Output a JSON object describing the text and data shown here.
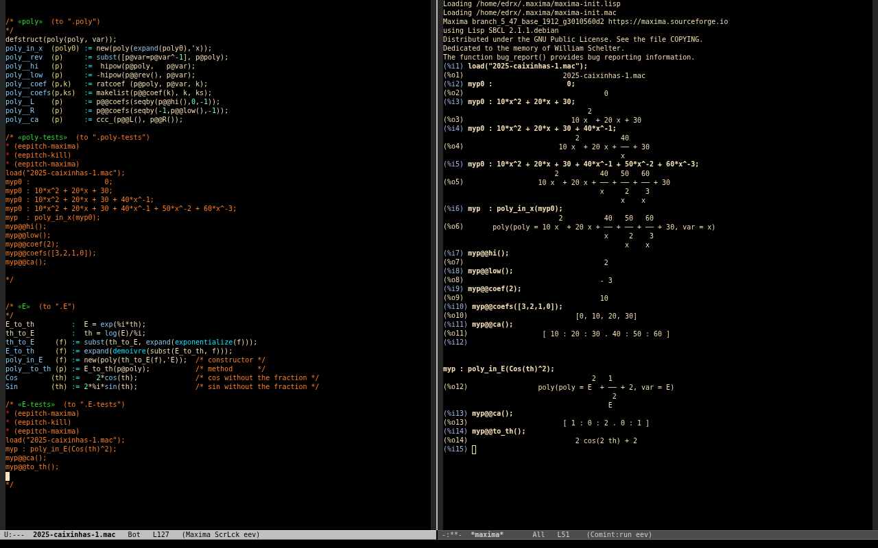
{
  "windows": [
    {
      "kind": "source",
      "selected": true,
      "lines": [
        {
          "kind": "blank"
        },
        {
          "kind": "blank"
        },
        {
          "kind": "code",
          "parts": [
            {
              "kind": "comment",
              "text": "/* "
            },
            {
              "kind": "anchor",
              "text": "«poly»"
            },
            {
              "kind": "comment",
              "text": "  (to \".poly\")"
            }
          ]
        },
        {
          "kind": "code",
          "parts": [
            {
              "kind": "comment",
              "text": "*/"
            }
          ]
        },
        {
          "kind": "code",
          "parts": [
            {
              "kind": "plain",
              "text": "defstruct(poly(poly, var));"
            }
          ]
        },
        {
          "kind": "code",
          "parts": [
            {
              "kind": "def",
              "text": "poly_in_x  "
            },
            {
              "kind": "param",
              "text": "(poly0) "
            },
            {
              "kind": "op",
              "text": ":= "
            },
            {
              "kind": "plain",
              "text": "new(poly("
            },
            {
              "kind": "builtin",
              "text": "expand"
            },
            {
              "kind": "plain",
              "text": "(poly0),'x));"
            }
          ]
        },
        {
          "kind": "code",
          "parts": [
            {
              "kind": "def",
              "text": "poly__rev  "
            },
            {
              "kind": "param",
              "text": "(p)     "
            },
            {
              "kind": "op",
              "text": ":= "
            },
            {
              "kind": "builtin",
              "text": "subst"
            },
            {
              "kind": "plain",
              "text": "([p@var=p@var^"
            },
            {
              "kind": "number",
              "text": "-1"
            },
            {
              "kind": "plain",
              "text": "], p@poly);"
            }
          ]
        },
        {
          "kind": "code",
          "parts": [
            {
              "kind": "def",
              "text": "poly__hi   "
            },
            {
              "kind": "param",
              "text": "(p)     "
            },
            {
              "kind": "op",
              "text": ":= "
            },
            {
              "kind": "plain",
              "text": " hipow(p@poly,   p@var);"
            }
          ]
        },
        {
          "kind": "code",
          "parts": [
            {
              "kind": "def",
              "text": "poly__low  "
            },
            {
              "kind": "param",
              "text": "(p)     "
            },
            {
              "kind": "op",
              "text": ":= "
            },
            {
              "kind": "plain",
              "text": "-hipow(p@@rev(), p@var);"
            }
          ]
        },
        {
          "kind": "code",
          "parts": [
            {
              "kind": "def",
              "text": "poly__coef "
            },
            {
              "kind": "param",
              "text": "(p,k)   "
            },
            {
              "kind": "op",
              "text": ":= "
            },
            {
              "kind": "plain",
              "text": "ratcoef (p@poly, p@var, k);"
            }
          ]
        },
        {
          "kind": "code",
          "parts": [
            {
              "kind": "def",
              "text": "poly__coefs"
            },
            {
              "kind": "param",
              "text": "(p,ks)  "
            },
            {
              "kind": "op",
              "text": ":= "
            },
            {
              "kind": "plain",
              "text": "makelist(p@@coef(k), k, ks);"
            }
          ]
        },
        {
          "kind": "code",
          "parts": [
            {
              "kind": "def",
              "text": "poly__L    "
            },
            {
              "kind": "param",
              "text": "(p)     "
            },
            {
              "kind": "op",
              "text": ":= "
            },
            {
              "kind": "plain",
              "text": "p@@coefs(seqby(p@@hi(),"
            },
            {
              "kind": "number",
              "text": "0"
            },
            {
              "kind": "plain",
              "text": ","
            },
            {
              "kind": "number",
              "text": "-1"
            },
            {
              "kind": "plain",
              "text": "));"
            }
          ]
        },
        {
          "kind": "code",
          "parts": [
            {
              "kind": "def",
              "text": "poly__R    "
            },
            {
              "kind": "param",
              "text": "(p)     "
            },
            {
              "kind": "op",
              "text": ":= "
            },
            {
              "kind": "plain",
              "text": "p@@coefs(seqby("
            },
            {
              "kind": "number",
              "text": "-1"
            },
            {
              "kind": "plain",
              "text": ",p@@low(),"
            },
            {
              "kind": "number",
              "text": "-1"
            },
            {
              "kind": "plain",
              "text": "));"
            }
          ]
        },
        {
          "kind": "code",
          "parts": [
            {
              "kind": "def",
              "text": "poly__ca   "
            },
            {
              "kind": "param",
              "text": "(p)     "
            },
            {
              "kind": "op",
              "text": ":= "
            },
            {
              "kind": "plain",
              "text": "ccc_(p@@L(), p@@R());"
            }
          ]
        },
        {
          "kind": "blank"
        },
        {
          "kind": "code",
          "parts": [
            {
              "kind": "comment",
              "text": "/* "
            },
            {
              "kind": "anchor",
              "text": "«poly-tests»"
            },
            {
              "kind": "comment",
              "text": "  (to \".poly-tests\")"
            }
          ]
        },
        {
          "kind": "code",
          "parts": [
            {
              "kind": "star",
              "text": "*"
            },
            {
              "kind": "comment",
              "text": " (eepitch-maxima)"
            }
          ]
        },
        {
          "kind": "code",
          "parts": [
            {
              "kind": "star",
              "text": "*"
            },
            {
              "kind": "comment",
              "text": " (eepitch-kill)"
            }
          ]
        },
        {
          "kind": "code",
          "parts": [
            {
              "kind": "star",
              "text": "*"
            },
            {
              "kind": "comment",
              "text": " (eepitch-maxima)"
            }
          ]
        },
        {
          "kind": "code",
          "parts": [
            {
              "kind": "comment",
              "text": "load(\"2025-caixinhas-1.mac\");"
            }
          ]
        },
        {
          "kind": "code",
          "parts": [
            {
              "kind": "comment",
              "text": "myp0 :                  0;"
            }
          ]
        },
        {
          "kind": "code",
          "parts": [
            {
              "kind": "comment",
              "text": "myp0 : 10*x^2 + 20*x + 30;"
            }
          ]
        },
        {
          "kind": "code",
          "parts": [
            {
              "kind": "comment",
              "text": "myp0 : 10*x^2 + 20*x + 30 + 40*x^-1;"
            }
          ]
        },
        {
          "kind": "code",
          "parts": [
            {
              "kind": "comment",
              "text": "myp0 : 10*x^2 + 20*x + 30 + 40*x^-1 + 50*x^-2 + 60*x^-3;"
            }
          ]
        },
        {
          "kind": "code",
          "parts": [
            {
              "kind": "comment",
              "text": "myp  : poly_in_x(myp0);"
            }
          ]
        },
        {
          "kind": "code",
          "parts": [
            {
              "kind": "comment",
              "text": "myp@@hi();"
            }
          ]
        },
        {
          "kind": "code",
          "parts": [
            {
              "kind": "comment",
              "text": "myp@@low();"
            }
          ]
        },
        {
          "kind": "code",
          "parts": [
            {
              "kind": "comment",
              "text": "myp@@coef(2);"
            }
          ]
        },
        {
          "kind": "code",
          "parts": [
            {
              "kind": "comment",
              "text": "myp@@coefs([3,2,1,0]);"
            }
          ]
        },
        {
          "kind": "code",
          "parts": [
            {
              "kind": "comment",
              "text": "myp@@ca();"
            }
          ]
        },
        {
          "kind": "blank"
        },
        {
          "kind": "code",
          "parts": [
            {
              "kind": "comment",
              "text": "*/"
            }
          ]
        },
        {
          "kind": "blank"
        },
        {
          "kind": "blank"
        },
        {
          "kind": "code",
          "parts": [
            {
              "kind": "comment",
              "text": "/* "
            },
            {
              "kind": "anchor",
              "text": "«E»"
            },
            {
              "kind": "comment",
              "text": "  (to \".E\")"
            }
          ]
        },
        {
          "kind": "code",
          "parts": [
            {
              "kind": "comment",
              "text": "*/"
            }
          ]
        },
        {
          "kind": "code",
          "parts": [
            {
              "kind": "plain",
              "text": "E_to_th         "
            },
            {
              "kind": "op",
              "text": ":  "
            },
            {
              "kind": "plain",
              "text": "E = "
            },
            {
              "kind": "builtin",
              "text": "exp"
            },
            {
              "kind": "plain",
              "text": "(%i*th);"
            }
          ]
        },
        {
          "kind": "code",
          "parts": [
            {
              "kind": "plain",
              "text": "th_to_E         "
            },
            {
              "kind": "op",
              "text": ":  "
            },
            {
              "kind": "plain",
              "text": "th = "
            },
            {
              "kind": "builtin",
              "text": "log"
            },
            {
              "kind": "plain",
              "text": "(E)/%i;"
            }
          ]
        },
        {
          "kind": "code",
          "parts": [
            {
              "kind": "def",
              "text": "th_to_E     "
            },
            {
              "kind": "param",
              "text": "(f) "
            },
            {
              "kind": "op",
              "text": ":= "
            },
            {
              "kind": "builtin",
              "text": "subst"
            },
            {
              "kind": "plain",
              "text": "(th_to_E, "
            },
            {
              "kind": "builtin",
              "text": "expand"
            },
            {
              "kind": "plain",
              "text": "("
            },
            {
              "kind": "keyword",
              "text": "exponentialize"
            },
            {
              "kind": "plain",
              "text": "(f)));"
            }
          ]
        },
        {
          "kind": "code",
          "parts": [
            {
              "kind": "def",
              "text": "E_to_th     "
            },
            {
              "kind": "param",
              "text": "(f) "
            },
            {
              "kind": "op",
              "text": ":= "
            },
            {
              "kind": "builtin",
              "text": "expand"
            },
            {
              "kind": "plain",
              "text": "("
            },
            {
              "kind": "keyword",
              "text": "demoivre"
            },
            {
              "kind": "plain",
              "text": "(subst(E_to_th, f)));"
            }
          ]
        },
        {
          "kind": "code",
          "parts": [
            {
              "kind": "def",
              "text": "poly_in_E   "
            },
            {
              "kind": "param",
              "text": "(f) "
            },
            {
              "kind": "op",
              "text": ":= "
            },
            {
              "kind": "plain",
              "text": "new(poly(th_to_E(f),'E));  "
            },
            {
              "kind": "comment",
              "text": "/* constructor */"
            }
          ]
        },
        {
          "kind": "code",
          "parts": [
            {
              "kind": "def",
              "text": "poly__to_th "
            },
            {
              "kind": "param",
              "text": "(p) "
            },
            {
              "kind": "op",
              "text": ":= "
            },
            {
              "kind": "plain",
              "text": "E_to_th(p@poly);           "
            },
            {
              "kind": "comment",
              "text": "/* method      */"
            }
          ]
        },
        {
          "kind": "code",
          "parts": [
            {
              "kind": "def",
              "text": "Cos        "
            },
            {
              "kind": "param",
              "text": "(th) "
            },
            {
              "kind": "op",
              "text": ":=    "
            },
            {
              "kind": "number",
              "text": "2"
            },
            {
              "kind": "plain",
              "text": "*"
            },
            {
              "kind": "builtin",
              "text": "cos"
            },
            {
              "kind": "plain",
              "text": "(th);              "
            },
            {
              "kind": "comment",
              "text": "/* cos without the fraction */"
            }
          ]
        },
        {
          "kind": "code",
          "parts": [
            {
              "kind": "def",
              "text": "Sin        "
            },
            {
              "kind": "param",
              "text": "(th) "
            },
            {
              "kind": "op",
              "text": ":= "
            },
            {
              "kind": "number",
              "text": "2"
            },
            {
              "kind": "plain",
              "text": "*%i*"
            },
            {
              "kind": "builtin",
              "text": "sin"
            },
            {
              "kind": "plain",
              "text": "(th);              "
            },
            {
              "kind": "comment",
              "text": "/* sin without the fraction */"
            }
          ]
        },
        {
          "kind": "blank"
        },
        {
          "kind": "code",
          "parts": [
            {
              "kind": "comment",
              "text": "/* "
            },
            {
              "kind": "anchor",
              "text": "«E-tests»"
            },
            {
              "kind": "comment",
              "text": "  (to \".E-tests\")"
            }
          ]
        },
        {
          "kind": "code",
          "parts": [
            {
              "kind": "star",
              "text": "*"
            },
            {
              "kind": "comment",
              "text": " (eepitch-maxima)"
            }
          ]
        },
        {
          "kind": "code",
          "parts": [
            {
              "kind": "star",
              "text": "*"
            },
            {
              "kind": "comment",
              "text": " (eepitch-kill)"
            }
          ]
        },
        {
          "kind": "code",
          "parts": [
            {
              "kind": "star",
              "text": "*"
            },
            {
              "kind": "comment",
              "text": " (eepitch-maxima)"
            }
          ]
        },
        {
          "kind": "code",
          "parts": [
            {
              "kind": "comment",
              "text": "load(\"2025-caixinhas-1.mac\");"
            }
          ]
        },
        {
          "kind": "code",
          "parts": [
            {
              "kind": "comment",
              "text": "myp : poly_in_E(Cos(th)^2);"
            }
          ]
        },
        {
          "kind": "code",
          "parts": [
            {
              "kind": "comment",
              "text": "myp@@ca();"
            }
          ]
        },
        {
          "kind": "code",
          "parts": [
            {
              "kind": "comment",
              "text": "myp@@to_th();"
            }
          ]
        },
        {
          "kind": "cursor"
        },
        {
          "kind": "code",
          "parts": [
            {
              "kind": "comment",
              "text": "*/"
            }
          ]
        }
      ],
      "mode_line": {
        "state": "U:---",
        "buffer": "2025-caixinhas-1.mac",
        "position": "Bot",
        "line": "L127",
        "modes": "(Maxima ScrLck eev)"
      }
    },
    {
      "kind": "repl",
      "selected": false,
      "lines": [
        {
          "kind": "text",
          "text": "Loading /home/edrx/.maxima/maxima-init.lisp"
        },
        {
          "kind": "text",
          "text": "Loading /home/edrx/.maxima/maxima-init.mac"
        },
        {
          "kind": "text",
          "text": "Maxima branch_5_47_base_1912_g3010560d2 https://maxima.sourceforge.io"
        },
        {
          "kind": "text",
          "text": "using Lisp SBCL 2.1.1.debian"
        },
        {
          "kind": "text",
          "text": "Distributed under the GNU Public License. See the file COPYING."
        },
        {
          "kind": "text",
          "text": "Dedicated to the memory of William Schelter."
        },
        {
          "kind": "text",
          "text": "The function bug_report() provides bug reporting information."
        },
        {
          "kind": "input",
          "prompt": "(%i1)",
          "text": "load(\"2025-caixinhas-1.mac\");"
        },
        {
          "kind": "output",
          "prompt": "(%o1)",
          "value": "2025-caixinhas-1.mac"
        },
        {
          "kind": "input",
          "prompt": "(%i2)",
          "text": "myp0 :                  0;"
        },
        {
          "kind": "output",
          "prompt": "(%o2)",
          "value": "0"
        },
        {
          "kind": "input",
          "prompt": "(%i3)",
          "text": "myp0 : 10*x^2 + 20*x + 30;"
        },
        {
          "kind": "output",
          "prompt": "(%o3)",
          "rows_above": [
            "    2"
          ],
          "value": "10 x  + 20 x + 30"
        },
        {
          "kind": "input",
          "prompt": "(%i4)",
          "text": "myp0 : 10*x^2 + 20*x + 30 + 40*x^-1;"
        },
        {
          "kind": "output",
          "prompt": "(%o4)",
          "rows_above": [
            "    2          40"
          ],
          "value": "10 x  + 20 x + ── + 30",
          "rows_below": [
            "               x"
          ]
        },
        {
          "kind": "input",
          "prompt": "(%i5)",
          "text": "myp0 : 10*x^2 + 20*x + 30 + 40*x^-1 + 50*x^-2 + 60*x^-3;"
        },
        {
          "kind": "output",
          "prompt": "(%o5)",
          "rows_above": [
            "    2          40   50   60"
          ],
          "value": "10 x  + 20 x + ── + ── + ── + 30",
          "rows_below": [
            "               x     2    3",
            "                    x    x"
          ]
        },
        {
          "kind": "input",
          "prompt": "(%i6)",
          "text": "myp  : poly_in_x(myp0);"
        },
        {
          "kind": "output",
          "prompt": "(%o6)",
          "rows_above": [
            "                2          40   50   60"
          ],
          "value": "poly(poly = 10 x  + 20 x + ── + ── + ── + 30, var = x)",
          "rows_below": [
            "                           x     2    3",
            "                                x    x"
          ]
        },
        {
          "kind": "input",
          "prompt": "(%i7)",
          "text": "myp@@hi();"
        },
        {
          "kind": "output",
          "prompt": "(%o7)",
          "value": "2"
        },
        {
          "kind": "input",
          "prompt": "(%i8)",
          "text": "myp@@low();"
        },
        {
          "kind": "output",
          "prompt": "(%o8)",
          "value": "- 3"
        },
        {
          "kind": "input",
          "prompt": "(%i9)",
          "text": "myp@@coef(2);"
        },
        {
          "kind": "output",
          "prompt": "(%o9)",
          "value": "10"
        },
        {
          "kind": "input",
          "prompt": "(%i10)",
          "text": "myp@@coefs([3,2,1,0]);"
        },
        {
          "kind": "output",
          "prompt": "(%o10)",
          "value": "[0, 10, 20, 30]"
        },
        {
          "kind": "input",
          "prompt": "(%i11)",
          "text": "myp@@ca();"
        },
        {
          "kind": "output",
          "prompt": "(%o11)",
          "value": "[ 10 : 20 : 30 . 40 : 50 : 60 ]"
        },
        {
          "kind": "prompt",
          "prompt": "(%i12)",
          "cursor": false
        },
        {
          "kind": "blank"
        },
        {
          "kind": "blank"
        },
        {
          "kind": "input",
          "text": "myp : poly_in_E(Cos(th)^2);"
        },
        {
          "kind": "output",
          "prompt": "(%o12)",
          "rows_above": [
            "             2   1"
          ],
          "value": "poly(poly = E  + ── + 2, var = E)",
          "rows_below": [
            "                  2",
            "                 E"
          ]
        },
        {
          "kind": "input",
          "prompt": "(%i13)",
          "text": "myp@@ca();"
        },
        {
          "kind": "output",
          "prompt": "(%o13)",
          "value": "[ 1 : 0 : 2 . 0 : 1 ]"
        },
        {
          "kind": "input",
          "prompt": "(%i14)",
          "text": "myp@@to_th();"
        },
        {
          "kind": "output",
          "prompt": "(%o14)",
          "value": "2 cos(2 th) + 2"
        },
        {
          "kind": "prompt",
          "prompt": "(%i15)",
          "cursor": true
        }
      ],
      "mode_line": {
        "state": "-:**-",
        "buffer": "*maxima*",
        "position": "All",
        "line": "L51",
        "modes": "(Comint:run eev)"
      }
    }
  ]
}
